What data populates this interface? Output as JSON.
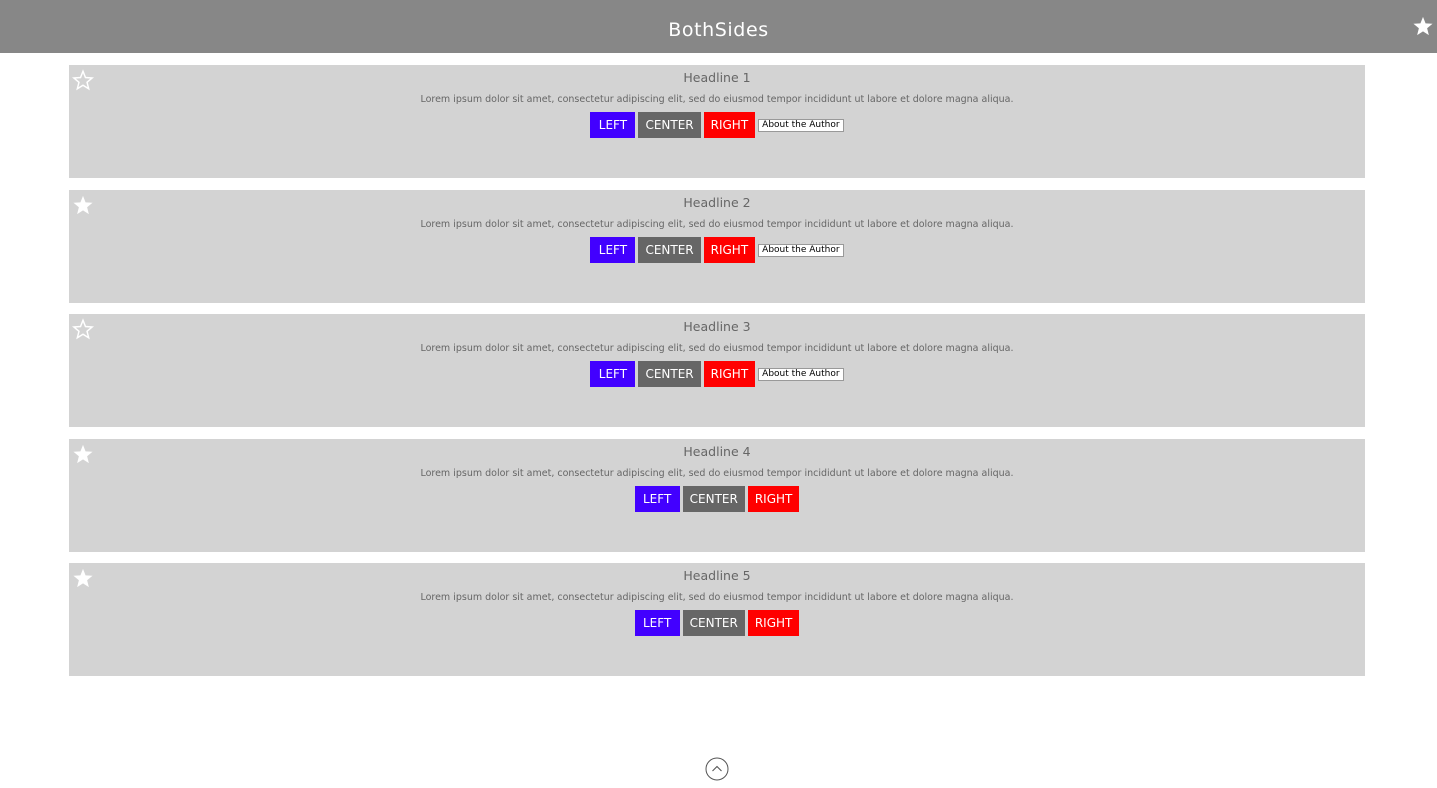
{
  "header": {
    "title": "BothSides",
    "star_icon": "filled-star-icon"
  },
  "colors": {
    "header_bg": "#878787",
    "card_bg": "#d3d3d3",
    "left": "#4200ff",
    "center": "#666666",
    "right": "#ff0000",
    "text": "#666666"
  },
  "cards": [
    {
      "headline": "Headline 1",
      "body": "Lorem ipsum dolor sit amet, consectetur adipiscing elit, sed do eiusmod tempor incididunt ut labore et dolore magna aliqua.",
      "starred": false,
      "star_icon": "outline-star-icon",
      "buttons": {
        "left": "LEFT",
        "center": "CENTER",
        "right": "RIGHT",
        "author": "About the Author"
      }
    },
    {
      "headline": "Headline 2",
      "body": "Lorem ipsum dolor sit amet, consectetur adipiscing elit, sed do eiusmod tempor incididunt ut labore et dolore magna aliqua.",
      "starred": true,
      "star_icon": "filled-star-icon",
      "buttons": {
        "left": "LEFT",
        "center": "CENTER",
        "right": "RIGHT",
        "author": "About the Author"
      }
    },
    {
      "headline": "Headline 3",
      "body": "Lorem ipsum dolor sit amet, consectetur adipiscing elit, sed do eiusmod tempor incididunt ut labore et dolore magna aliqua.",
      "starred": false,
      "star_icon": "outline-star-icon",
      "buttons": {
        "left": "LEFT",
        "center": "CENTER",
        "right": "RIGHT",
        "author": "About the Author"
      }
    },
    {
      "headline": "Headline 4",
      "body": "Lorem ipsum dolor sit amet, consectetur adipiscing elit, sed do eiusmod tempor incididunt ut labore et dolore magna aliqua.",
      "starred": true,
      "star_icon": "filled-star-icon",
      "buttons": {
        "left": "LEFT",
        "center": "CENTER",
        "right": "RIGHT"
      }
    },
    {
      "headline": "Headline 5",
      "body": "Lorem ipsum dolor sit amet, consectetur adipiscing elit, sed do eiusmod tempor incididunt ut labore et dolore magna aliqua.",
      "starred": true,
      "star_icon": "filled-star-icon",
      "buttons": {
        "left": "LEFT",
        "center": "CENTER",
        "right": "RIGHT"
      }
    }
  ],
  "footer": {
    "scroll_top_icon": "chevron-up-circle-icon"
  }
}
